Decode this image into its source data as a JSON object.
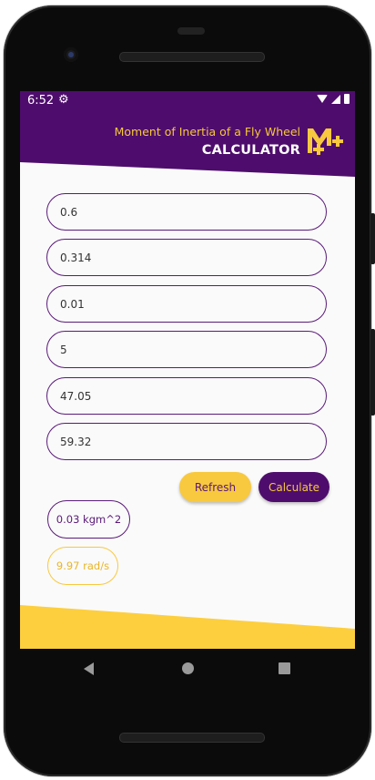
{
  "status_bar": {
    "time": "6:52"
  },
  "header": {
    "title_line1": "Moment of Inertia of a Fly Wheel",
    "title_line2": "CALCULATOR",
    "logo_text": "M+",
    "colors": {
      "primary": "#4e0d6c",
      "accent": "#f8c93e"
    }
  },
  "inputs": [
    {
      "value": "0.6"
    },
    {
      "value": "0.314"
    },
    {
      "value": "0.01"
    },
    {
      "value": "5"
    },
    {
      "value": "47.05"
    },
    {
      "value": "59.32"
    }
  ],
  "buttons": {
    "refresh": "Refresh",
    "calculate": "Calculate"
  },
  "results": {
    "inertia": "0.03 kgm^2",
    "angular_velocity": "9.97 rad/s"
  },
  "navigation": {
    "icons": [
      "back-icon",
      "home-icon",
      "recents-icon"
    ]
  }
}
